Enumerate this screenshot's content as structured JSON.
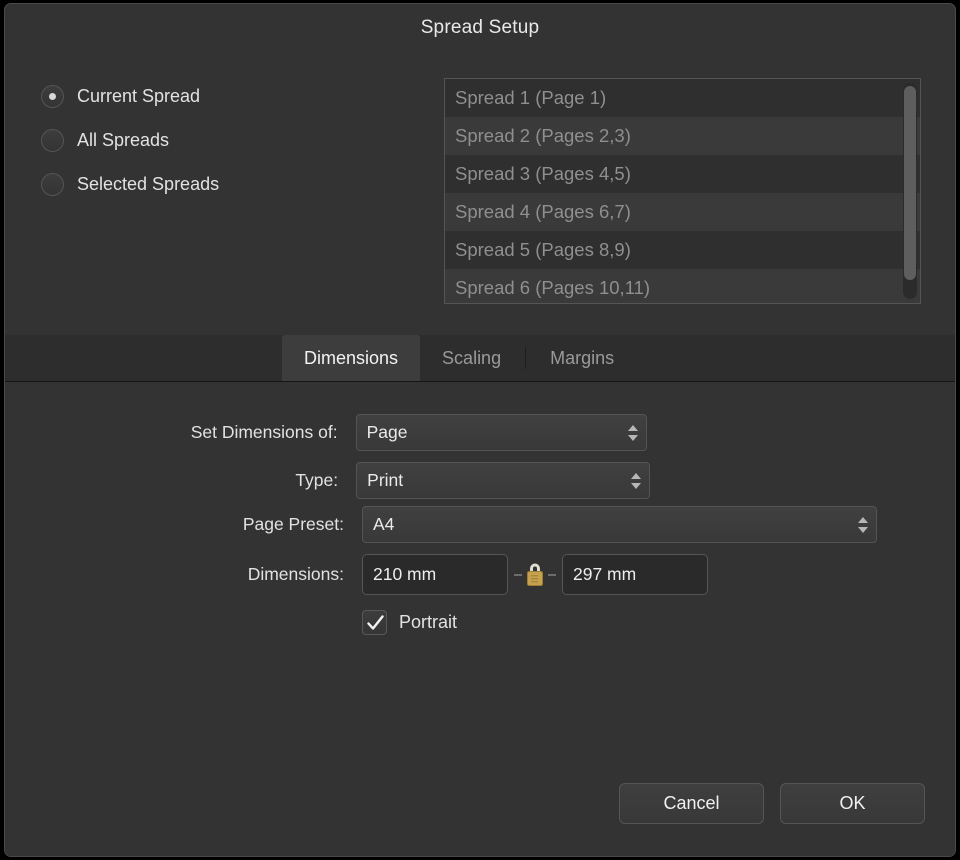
{
  "dialog": {
    "title": "Spread Setup"
  },
  "scope": {
    "options": [
      {
        "label": "Current Spread",
        "selected": true
      },
      {
        "label": "All Spreads",
        "selected": false
      },
      {
        "label": "Selected Spreads",
        "selected": false
      }
    ]
  },
  "spread_list": {
    "items": [
      "Spread 1 (Page 1)",
      "Spread 2 (Pages 2,3)",
      "Spread 3 (Pages 4,5)",
      "Spread 4 (Pages 6,7)",
      "Spread 5 (Pages 8,9)",
      "Spread 6 (Pages 10,11)"
    ]
  },
  "tabs": [
    {
      "label": "Dimensions",
      "active": true
    },
    {
      "label": "Scaling",
      "active": false
    },
    {
      "label": "Margins",
      "active": false
    }
  ],
  "form": {
    "set_dimensions_of": {
      "label": "Set Dimensions of:",
      "value": "Page"
    },
    "type": {
      "label": "Type:",
      "value": "Print"
    },
    "page_preset": {
      "label": "Page Preset:",
      "value": "A4"
    },
    "dimensions": {
      "label": "Dimensions:",
      "width": "210 mm",
      "height": "297 mm",
      "lock_icon": "lock-closed-icon",
      "lock_locked": true
    },
    "portrait": {
      "label": "Portrait",
      "checked": true
    }
  },
  "footer": {
    "cancel_label": "Cancel",
    "ok_label": "OK"
  },
  "colors": {
    "dialog_bg": "#333333",
    "tabbar_bg": "#2d2d2d",
    "active_tab_bg": "#3d3d3d",
    "field_bg": "#2a2a2a",
    "list_bg": "#2f2f2f",
    "list_alt_row": "#3a3a3a",
    "text_primary": "#e9e9e9",
    "text_muted": "#8f8f8f",
    "lock_gold": "#c9a košt"
  }
}
